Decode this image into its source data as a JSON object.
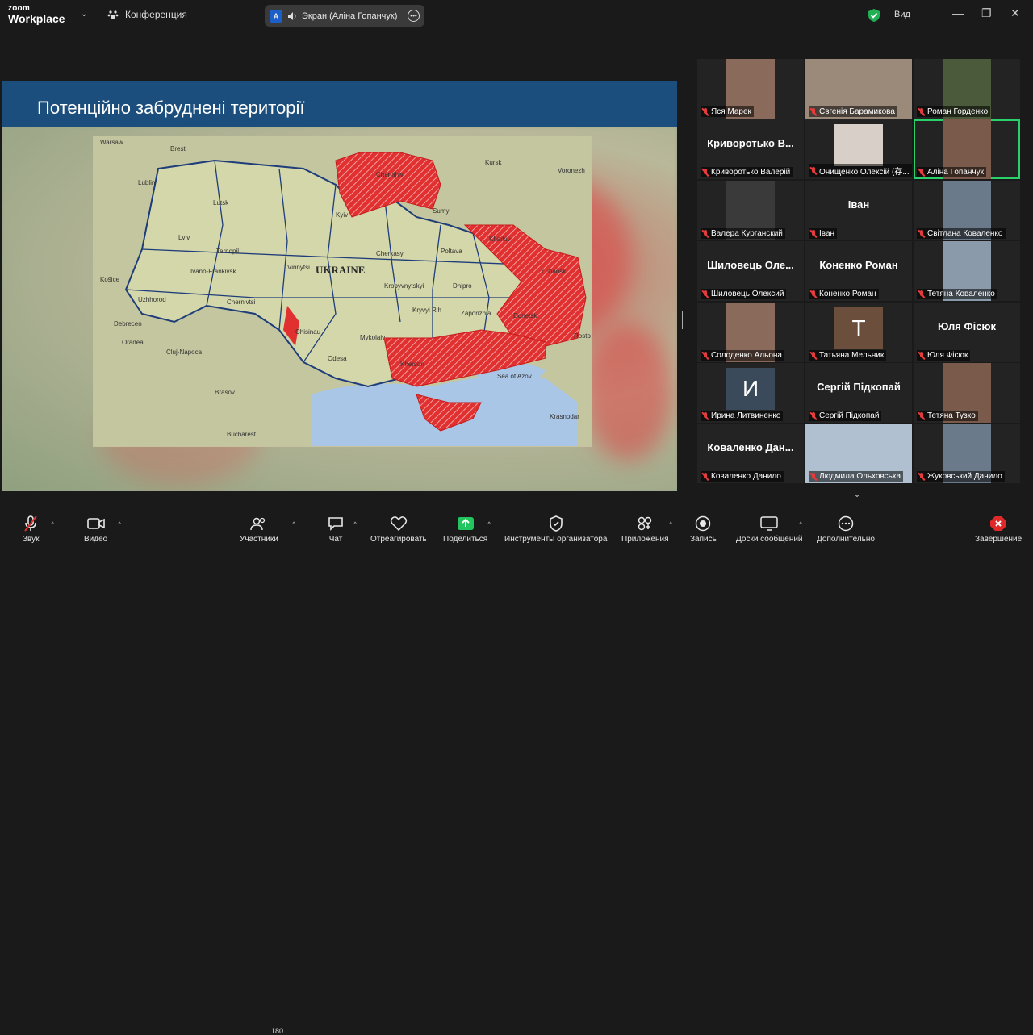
{
  "app": {
    "logo_line1": "zoom",
    "logo_line2": "Workplace",
    "conference_label": "Конференция",
    "share_initial": "A",
    "share_label": "Экран (Аліна Гопанчук)",
    "view_label": "Вид",
    "window_controls": [
      "—",
      "❐",
      "✕"
    ]
  },
  "slide": {
    "title": "Потенційно забруднені території",
    "map_labels": {
      "country": "UKRAINE",
      "cities": [
        "Warsaw",
        "Brest",
        "Lublin",
        "Lutsk",
        "Lviv",
        "Ternopil",
        "Ivano-Frankivsk",
        "Uzhhorod",
        "Chernivtsi",
        "Vinnytsi",
        "Kyiv",
        "Chernihiv",
        "Kursk",
        "Voronezh",
        "Sumy",
        "Kharkiv",
        "Poltava",
        "Cherkasy",
        "Dnipro",
        "Zaporizhia",
        "Kryvyi Rih",
        "Kropyvnytskyi",
        "Mykolaiv",
        "Odesa",
        "Kherson",
        "Donetsk",
        "Luhansk",
        "Krasnodar",
        "Rostov",
        "Chisinau",
        "Cluj-Napoca",
        "Debrecen",
        "Košice",
        "Oradea",
        "Brasov",
        "Bucharest",
        "Sea of Azov"
      ]
    }
  },
  "participants": [
    {
      "name": "Яся Марек",
      "kind": "video"
    },
    {
      "name": "Євгенія Барамикова",
      "kind": "video"
    },
    {
      "name": "Роман Горденко",
      "kind": "video"
    },
    {
      "name": "Криворотько Валерій",
      "kind": "text",
      "big": "Криворотько В..."
    },
    {
      "name": "Онищенко Олексій (存...",
      "kind": "avatar"
    },
    {
      "name": "Аліна Гопанчук",
      "kind": "video",
      "active": true
    },
    {
      "name": "Валера Курганский",
      "kind": "video"
    },
    {
      "name": "Іван",
      "kind": "text",
      "big": "Іван"
    },
    {
      "name": "Світлана Коваленко",
      "kind": "video"
    },
    {
      "name": "Шиловець Олексий",
      "kind": "text",
      "big": "Шиловець Оле..."
    },
    {
      "name": "Коненко Роман",
      "kind": "text",
      "big": "Коненко Роман"
    },
    {
      "name": "Тетяна Коваленко",
      "kind": "video"
    },
    {
      "name": "Солоденко Альона",
      "kind": "video"
    },
    {
      "name": "Татьяна Мельник",
      "kind": "letter",
      "letter": "Т"
    },
    {
      "name": "Юля Фісюк",
      "kind": "text",
      "big": "Юля Фісюк"
    },
    {
      "name": "Ирина Литвиненко",
      "kind": "letter",
      "letter": "И"
    },
    {
      "name": "Сергій Підкопай",
      "kind": "text",
      "big": "Сергій Підкопай"
    },
    {
      "name": "Тетяна Тузко",
      "kind": "video"
    },
    {
      "name": "Коваленко Данило",
      "kind": "text",
      "big": "Коваленко Дан..."
    },
    {
      "name": "Людмила Ольховська",
      "kind": "video"
    },
    {
      "name": "Жуковський Данило",
      "kind": "video"
    }
  ],
  "toolbar": {
    "audio": "Звук",
    "video": "Видео",
    "participants": "Участники",
    "participants_count": "180",
    "chat": "Чат",
    "react": "Отреагировать",
    "share": "Поделиться",
    "host_tools": "Инструменты организатора",
    "apps": "Приложения",
    "record": "Запись",
    "whiteboards": "Доски сообщений",
    "more": "Дополнительно",
    "end": "Завершение"
  },
  "colors": {
    "accent_green": "#2ad06a",
    "share_green": "#22c55e",
    "end_red": "#e02828",
    "slide_header": "#1b4e7c",
    "occupied_red": "#e03030"
  }
}
